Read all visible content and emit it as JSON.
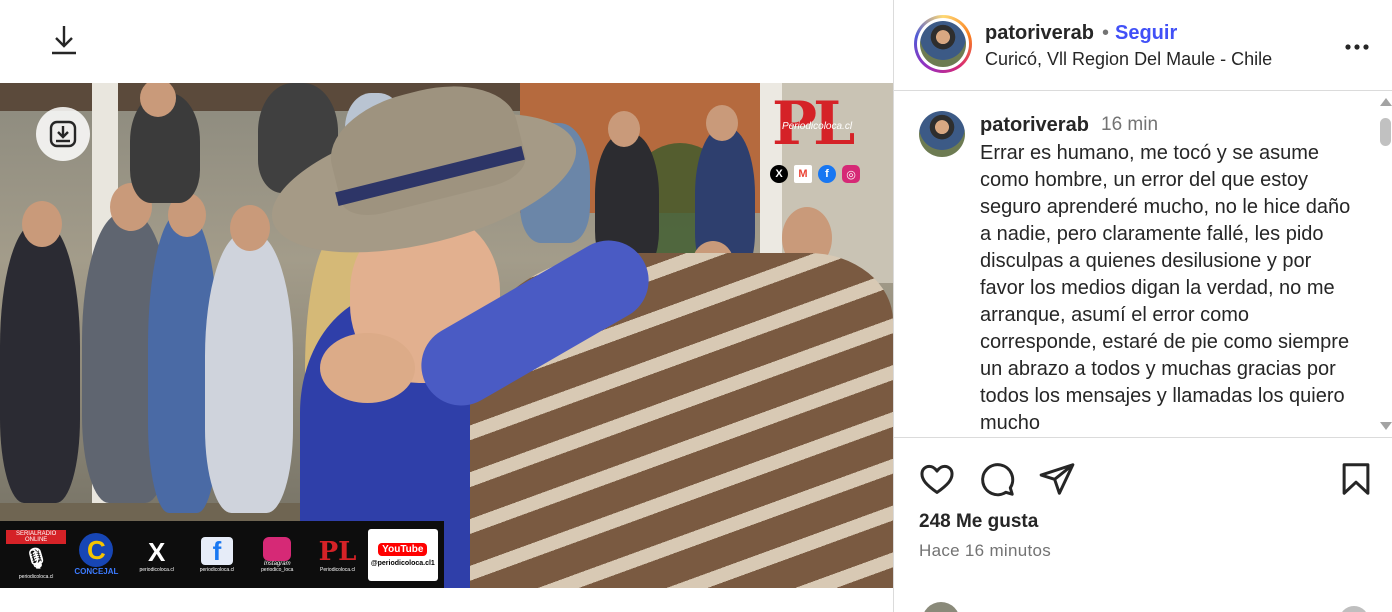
{
  "media": {
    "download_icon": "download-icon",
    "save_media_icon": "download-tray-icon",
    "watermark": {
      "logo": "PL",
      "site": "Periodicoloca.cl",
      "socials": [
        "x-icon",
        "gmail-icon",
        "facebook-icon",
        "instagram-icon"
      ]
    },
    "bottom_strip": [
      {
        "name": "radio-online",
        "label": "SERIALRADIO ONLINE",
        "sub": "periodicoloca.cl"
      },
      {
        "name": "concejal-logo",
        "label": "CONCEJAL",
        "big": "C"
      },
      {
        "name": "x-logo",
        "big": "X",
        "sub": "periodicoloca.cl"
      },
      {
        "name": "facebook-logo",
        "big": "f",
        "sub": "periodicoloca.cl"
      },
      {
        "name": "instagram-logo",
        "label": "Instagram",
        "sub": "periodico_loca"
      },
      {
        "name": "pl-logo",
        "big": "PL",
        "sub": "Periodicoloca.cl"
      },
      {
        "name": "youtube-logo",
        "label": "YouTube",
        "sub": "@periodicoloca.cl1"
      }
    ]
  },
  "post": {
    "username": "patoriverab",
    "separator": "•",
    "follow_label": "Seguir",
    "location": "Curicó, Vll Region Del Maule - Chile",
    "more_icon": "more-options-icon",
    "caption": {
      "username": "patoriverab",
      "time": "16 min",
      "text": "Errar es humano, me tocó y se asume como hombre, un error del que estoy seguro aprenderé mucho, no le hice daño a nadie, pero claramente fallé, les pido disculpas a quienes desilusione y por favor los medios digan la verdad, no me arranque, asumí el error como corresponde, estaré de pie como siempre un abrazo a todos y muchas gracias por todos los mensajes y llamadas los quiero mucho"
    },
    "actions": [
      "heart-icon",
      "comment-icon",
      "share-icon",
      "bookmark-icon"
    ],
    "likes_text": "248 Me gusta",
    "posted_ago": "Hace 16 minutos"
  }
}
